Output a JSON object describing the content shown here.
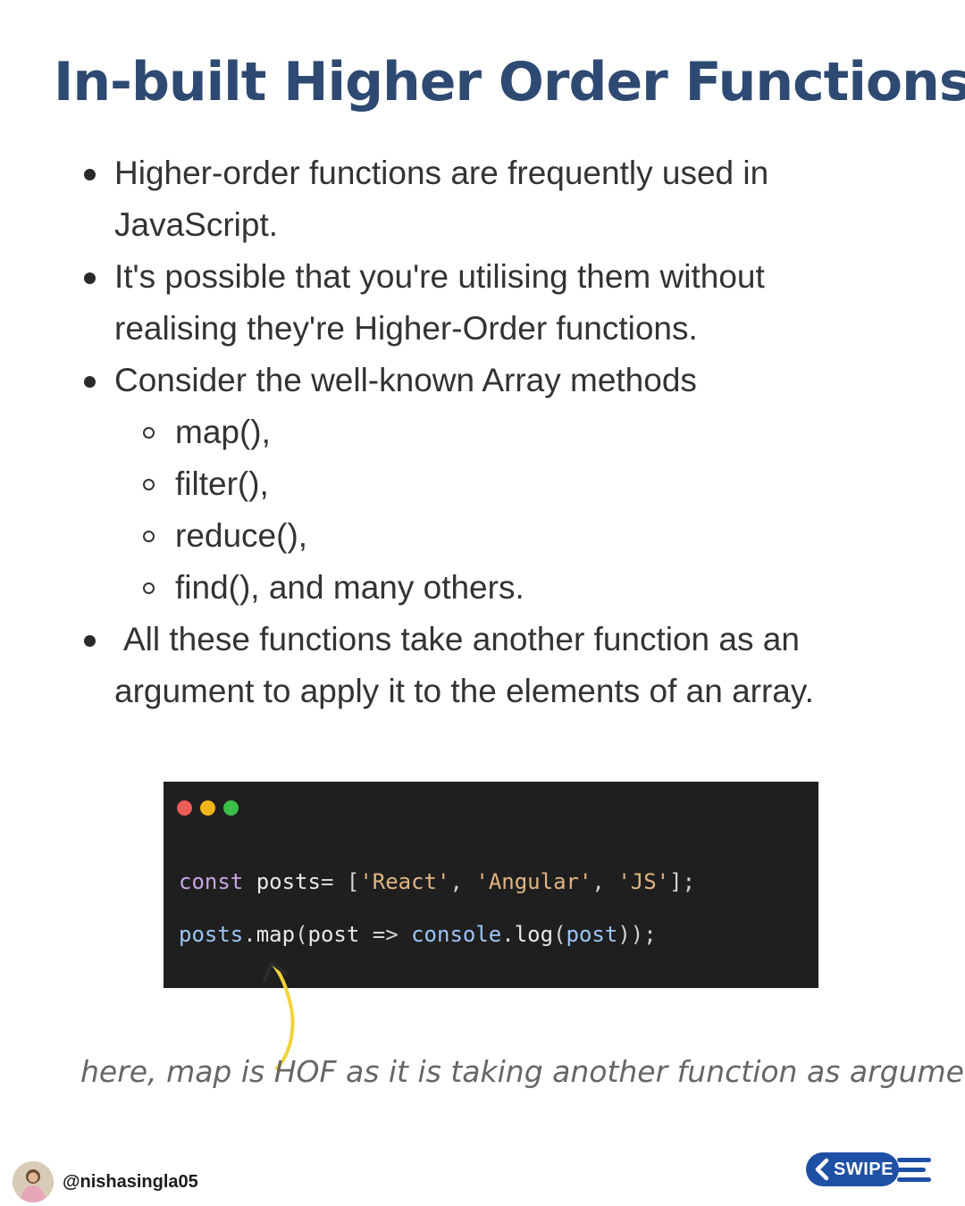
{
  "title": "In-built Higher Order Functions",
  "bullets": {
    "b1": {
      "line1": "Higher-order functions are frequently used in",
      "line2": "JavaScript."
    },
    "b2": {
      "line1": "It's possible that you're utilising them without",
      "line2": "realising they're Higher-Order functions."
    },
    "b3": {
      "line1": "Consider the well-known Array methods",
      "sub_items": [
        "map(),",
        "filter(),",
        "reduce(),",
        "find(), and many others."
      ]
    },
    "b4": {
      "line1": "All these functions take another function as an",
      "line2": "argument to apply it to the elements of an array."
    }
  },
  "code": {
    "line1": {
      "kw": "const",
      "ident": " posts",
      "eq": "= [",
      "s1": "'React'",
      "c1": ", ",
      "s2": "'Angular'",
      "c2": ", ",
      "s3": "'JS'",
      "end": "];"
    },
    "line2": {
      "obj": "posts",
      "dot": ".",
      "method": "map",
      "open": "(",
      "param": "post",
      "arrow": " => ",
      "console": "console",
      "dot2": ".",
      "log": "log",
      "open2": "(",
      "arg": "post",
      "close": "));"
    },
    "colors": {
      "background": "#1f1f1f",
      "keyword": "#c9a6e6",
      "string": "#e0b582",
      "function": "#9ec5f8"
    }
  },
  "caption": "here, map is HOF as it is taking another function as argument",
  "footer": {
    "handle": "@nishasingla05",
    "swipe_label": "SWIPE"
  },
  "colors": {
    "title": "#2e4a72",
    "body_text": "#333333",
    "arrow": "#f2d33a",
    "swipe_badge": "#1e50a5"
  },
  "icons": {
    "window_dots": [
      "red-dot-icon",
      "yellow-dot-icon",
      "green-dot-icon"
    ],
    "arrow": "curved-arrow-icon",
    "swipe": "chevron-left-icon",
    "menu": "speed-lines-icon"
  }
}
